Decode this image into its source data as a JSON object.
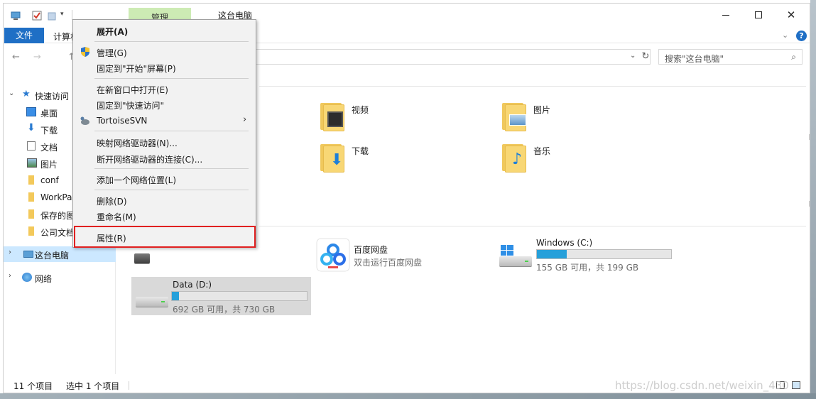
{
  "window": {
    "title": "这台电脑",
    "manage_tab": "管理",
    "file_tab": "文件",
    "ribbon_tab": "计算机",
    "help": "?"
  },
  "address": {
    "search_placeholder": "搜索\"这台电脑\""
  },
  "nav": {
    "quick_access": "快速访问",
    "items": [
      {
        "label": "桌面",
        "icon": "desktop-icon"
      },
      {
        "label": "下载",
        "icon": "download-icon"
      },
      {
        "label": "文档",
        "icon": "document-icon"
      },
      {
        "label": "图片",
        "icon": "picture-icon"
      },
      {
        "label": "conf",
        "icon": "folder-icon"
      },
      {
        "label": "WorkPa",
        "icon": "folder-icon"
      },
      {
        "label": "保存的图",
        "icon": "folder-icon"
      },
      {
        "label": "公司文档",
        "icon": "folder-icon"
      }
    ],
    "this_pc": "这台电脑",
    "network": "网络"
  },
  "folders": [
    {
      "label": "视频",
      "icon": "video-folder-icon"
    },
    {
      "label": "图片",
      "icon": "pictures-folder-icon"
    },
    {
      "label": "下载",
      "icon": "downloads-folder-icon"
    },
    {
      "label": "音乐",
      "icon": "music-folder-icon"
    }
  ],
  "apps": {
    "baidu": {
      "name": "百度网盘",
      "desc": "双击运行百度网盘"
    }
  },
  "drives": {
    "c": {
      "name": "Windows (C:)",
      "space": "155 GB 可用，共 199 GB",
      "used_fraction": 0.22
    },
    "d": {
      "name": "Data (D:)",
      "space": "692 GB 可用，共 730 GB",
      "used_fraction": 0.05
    }
  },
  "status": {
    "count": "11 个项目",
    "selected": "选中 1 个项目"
  },
  "watermark": "https://blog.csdn.net/weixin_430",
  "context_menu": {
    "expand": "展开(A)",
    "manage": "管理(G)",
    "pin_start": "固定到\"开始\"屏幕(P)",
    "open_new_window": "在新窗口中打开(E)",
    "pin_quick": "固定到\"快速访问\"",
    "tortoise": "TortoiseSVN",
    "map_drive": "映射网络驱动器(N)...",
    "disconnect_drive": "断开网络驱动器的连接(C)...",
    "add_network": "添加一个网络位置(L)",
    "delete": "删除(D)",
    "rename": "重命名(M)",
    "properties": "属性(R)"
  },
  "colors": {
    "accent": "#1f6fc5",
    "manage_tab_bg": "#cdebb4",
    "selection": "#cce8ff",
    "drive_fill": "#26a0da",
    "highlight_border": "#e02020"
  }
}
